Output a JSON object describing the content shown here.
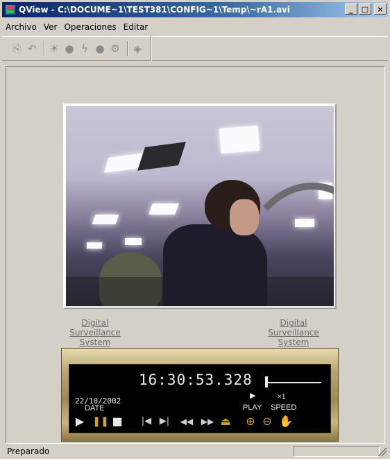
{
  "window": {
    "title": "QView - C:\\DOCUME~1\\TEST381\\CONFIG~1\\Temp\\~rA1.avi",
    "minimize_glyph": "_",
    "maximize_glyph": "□",
    "close_glyph": "×"
  },
  "menu": {
    "items": [
      "Archivo",
      "Ver",
      "Operaciones",
      "Editar"
    ]
  },
  "toolbar": {
    "icons": [
      "copy-icon",
      "undo-icon",
      "brightness-icon",
      "record-icon",
      "flash-icon",
      "dot-icon",
      "settings-icon",
      "snapshot-icon"
    ]
  },
  "overlay": {
    "left_caption": "Digital Surveillance System",
    "right_caption": "Digital Surveillance System"
  },
  "player": {
    "time": "16:30:53.328",
    "date": "22/10/2002",
    "date_label": "DATE",
    "play_label": "PLAY",
    "speed_value": "×1",
    "speed_label": "SPEED",
    "play_indicator": "▶",
    "controls": {
      "play": "▶",
      "pause": "❚❚",
      "stop": "■",
      "step_back": "|◀",
      "step_forward": "▶|",
      "fast_back": "◀◀",
      "fast_forward": "▶▶",
      "eject": "⏏",
      "zoom_in": "⊕",
      "zoom_out": "⊖",
      "pan": "✋"
    },
    "accent_color": "#c8a03a"
  },
  "status": {
    "text": "Preparado"
  }
}
